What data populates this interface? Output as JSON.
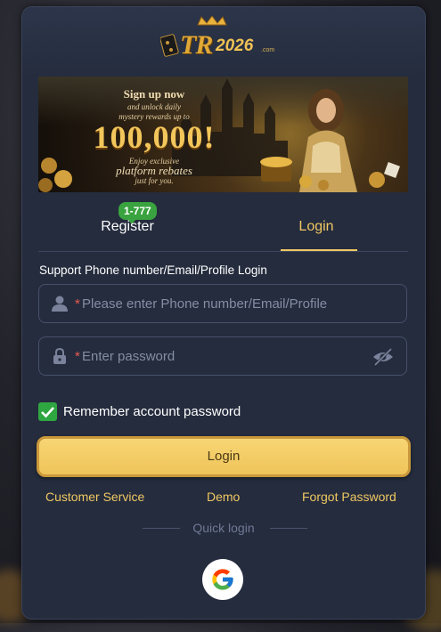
{
  "logo": {
    "text": "TR",
    "year": "2026",
    "suffix": ".com"
  },
  "banner": {
    "line1": "Sign up now",
    "line2": "and unlock daily",
    "line3": "mystery rewards up to",
    "amount": "100,000!",
    "line4": "Enjoy exclusive",
    "line5": "platform rebates",
    "line6": "just for you."
  },
  "tabs": {
    "register_label": "Register",
    "register_badge": "1-777",
    "login_label": "Login"
  },
  "form": {
    "support_text": "Support Phone number/Email/Profile Login",
    "required_mark": "*",
    "phone_placeholder": "Please enter Phone number/Email/Profile",
    "password_placeholder": "Enter password",
    "remember_label": "Remember account password",
    "remember_checked": true,
    "login_button": "Login"
  },
  "links": {
    "customer_service": "Customer Service",
    "demo": "Demo",
    "forgot_password": "Forgot Password"
  },
  "quick_login": {
    "label": "Quick login",
    "providers": [
      "google-icon"
    ]
  },
  "colors": {
    "accent": "#f0c862",
    "panel": "#252c3e",
    "badge": "#39a33f",
    "required": "#e85a4f"
  }
}
